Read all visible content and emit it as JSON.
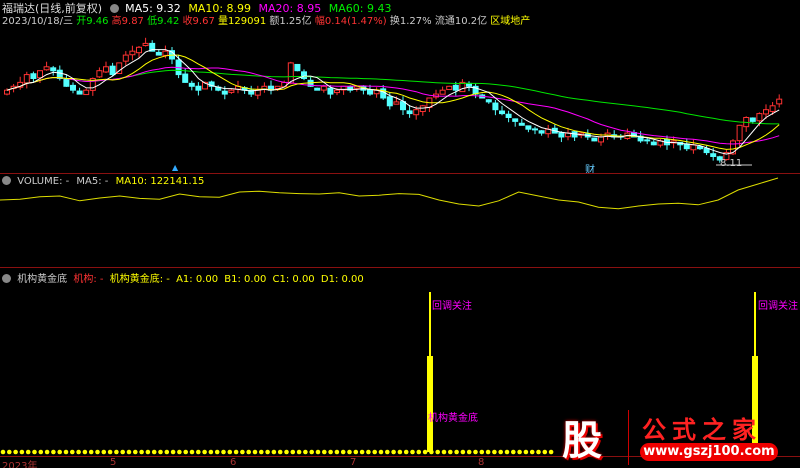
{
  "header": {
    "stock_name": "福瑞达(日线,前复权)",
    "ma5": "MA5: 9.32",
    "ma10": "MA10: 8.99",
    "ma20": "MA20: 8.95",
    "ma60": "MA60: 9.43",
    "date": "2023/10/18/三",
    "open": "开9.46",
    "high": "高9.87",
    "low": "低9.42",
    "close": "收9.67",
    "volume": "量129091",
    "amount": "额1.25亿",
    "change": "幅0.14(1.47%)",
    "turnover": "换1.27%",
    "float": "流通10.2亿",
    "sector": "区域地产"
  },
  "main": {
    "low_label": "8.11",
    "finance_marker": "财"
  },
  "volume_panel": {
    "title": "VOLUME: -",
    "ma5": "MA5: -",
    "ma10": "MA10: 122141.15"
  },
  "indicator": {
    "name": "机构黄金底",
    "jigou": "机构: -",
    "golden": "机构黄金底: -",
    "a1": "A1: 0.00",
    "b1": "B1: 0.00",
    "c1": "C1: 0.00",
    "d1": "D1: 0.00",
    "alert1": "回调关注",
    "alert2": "回调关注",
    "signal": "机构黄金底"
  },
  "xaxis": [
    "2023年",
    "5",
    "6",
    "7",
    "8"
  ],
  "logo": {
    "mark": "股",
    "name": "公式之家",
    "url": "www.gszj100.com"
  },
  "colors": {
    "up": "#ff3232",
    "down": "#54ffff",
    "ma5": "#ffffff",
    "ma10": "#ffff00",
    "ma20": "#ff00ff",
    "ma60": "#00e600"
  },
  "chart_data": {
    "type": "candlestick",
    "closes": [
      9.9,
      10.0,
      10.1,
      10.3,
      10.2,
      10.4,
      10.5,
      10.4,
      10.2,
      10.0,
      9.9,
      9.8,
      9.9,
      10.2,
      10.4,
      10.5,
      10.3,
      10.6,
      10.8,
      10.9,
      11.0,
      11.1,
      10.9,
      10.8,
      10.9,
      10.7,
      10.3,
      10.1,
      10.0,
      9.9,
      10.1,
      10.0,
      9.9,
      9.8,
      9.9,
      10.0,
      9.9,
      9.8,
      9.9,
      10.0,
      9.9,
      10.0,
      10.1,
      10.6,
      10.4,
      10.2,
      10.0,
      9.9,
      10.0,
      9.8,
      9.9,
      10.0,
      9.9,
      10.0,
      9.9,
      9.8,
      9.9,
      9.7,
      9.5,
      9.6,
      9.4,
      9.3,
      9.4,
      9.5,
      9.7,
      9.8,
      9.9,
      10.0,
      9.9,
      10.1,
      10.0,
      9.8,
      9.7,
      9.6,
      9.4,
      9.3,
      9.2,
      9.1,
      9.0,
      8.9,
      8.9,
      8.8,
      8.9,
      8.8,
      8.7,
      8.8,
      8.7,
      8.8,
      8.7,
      8.6,
      8.7,
      8.8,
      8.7,
      8.7,
      8.8,
      8.7,
      8.6,
      8.6,
      8.5,
      8.6,
      8.5,
      8.6,
      8.5,
      8.4,
      8.5,
      8.4,
      8.3,
      8.2,
      8.11,
      8.3,
      8.6,
      9.0,
      9.2,
      9.1,
      9.3,
      9.4,
      9.5,
      9.67
    ],
    "vol_ma10": [
      150,
      152,
      158,
      160,
      148,
      155,
      160,
      154,
      152,
      165,
      158,
      157,
      170,
      172,
      168,
      166,
      165,
      168,
      160,
      162,
      166,
      164,
      150,
      140,
      135,
      148,
      170,
      160,
      150,
      145,
      132,
      128,
      135,
      140,
      142,
      138,
      150,
      175,
      190,
      205
    ]
  }
}
